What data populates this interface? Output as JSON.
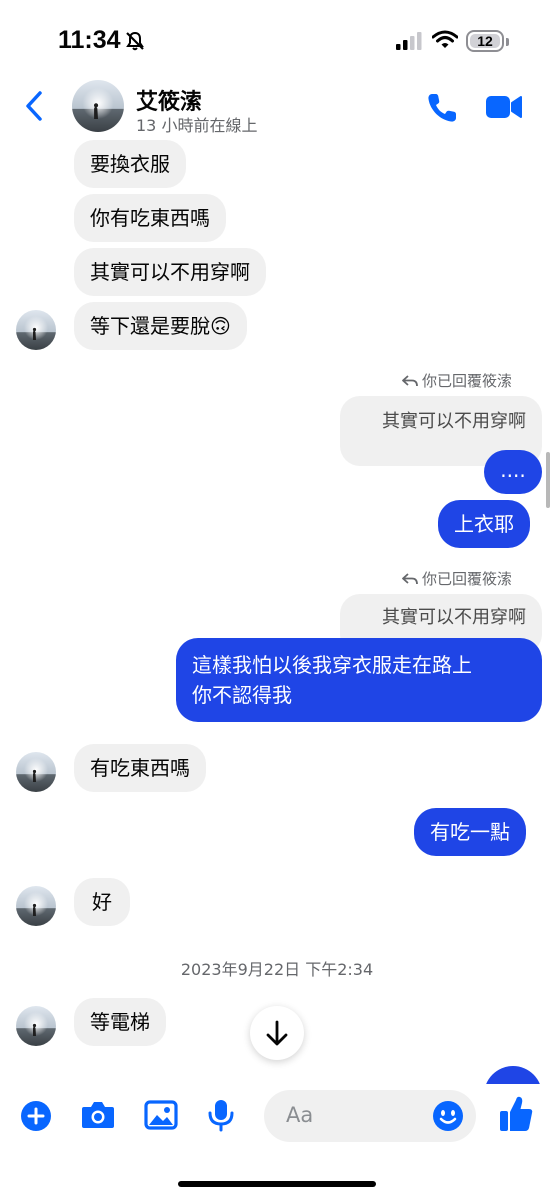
{
  "status_bar": {
    "time": "11:34",
    "battery": "12"
  },
  "header": {
    "name": "艾筱溹",
    "status": "13 小時前在線上"
  },
  "messages": {
    "m1": "要換衣服",
    "m2": "你有吃東西嗎",
    "m3": "其實可以不用穿啊",
    "m4": "等下還是要脫🙃",
    "reply_note_1": "你已回覆筱溹",
    "quote_1": "其實可以不用穿啊",
    "m5": "....",
    "m6": "上衣耶",
    "reply_note_2": "你已回覆筱溹",
    "quote_2": "其實可以不用穿啊",
    "m7_line1": "這樣我怕以後我穿衣服走在路上",
    "m7_line2": "你不認得我",
    "m8": "有吃東西嗎",
    "m9": "有吃一點",
    "m10": "好",
    "timestamp": "2023年9月22日 下午2:34",
    "m11": "等電梯"
  },
  "composer": {
    "placeholder": "Aa"
  },
  "colors": {
    "accent": "#1f45e6",
    "icon_blue": "#0866ff",
    "incoming_bubble": "#f0f0f0"
  }
}
